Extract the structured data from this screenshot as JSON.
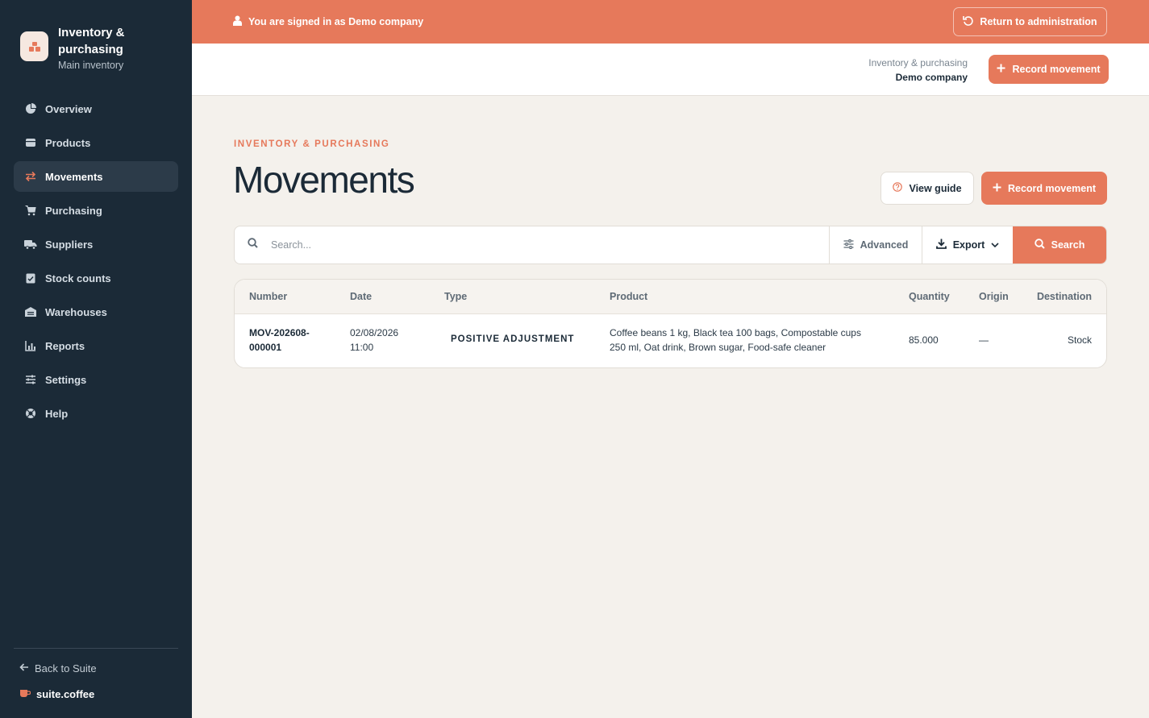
{
  "sidebar": {
    "brand_title": "Inventory & purchasing",
    "brand_subtitle": "Main inventory",
    "items": [
      {
        "label": "Overview",
        "icon": "pie-chart-icon"
      },
      {
        "label": "Products",
        "icon": "box-icon"
      },
      {
        "label": "Movements",
        "icon": "swap-arrows-icon",
        "active": true
      },
      {
        "label": "Purchasing",
        "icon": "cart-icon"
      },
      {
        "label": "Suppliers",
        "icon": "truck-icon"
      },
      {
        "label": "Stock counts",
        "icon": "clipboard-check-icon"
      },
      {
        "label": "Warehouses",
        "icon": "warehouse-icon"
      },
      {
        "label": "Reports",
        "icon": "bar-chart-icon"
      },
      {
        "label": "Settings",
        "icon": "sliders-icon"
      },
      {
        "label": "Help",
        "icon": "lifebuoy-icon"
      }
    ],
    "back_label": "Back to Suite",
    "suite_label": "suite.coffee"
  },
  "banner": {
    "text": "You are signed in as Demo company",
    "return_label": "Return to administration"
  },
  "header": {
    "app_name": "Inventory & purchasing",
    "company": "Demo company",
    "record_label": "Record movement"
  },
  "page": {
    "eyebrow": "INVENTORY & PURCHASING",
    "title": "Movements",
    "guide_label": "View guide",
    "record_label": "Record movement"
  },
  "search": {
    "placeholder": "Search...",
    "advanced_label": "Advanced",
    "export_label": "Export",
    "search_label": "Search"
  },
  "table": {
    "columns": [
      "Number",
      "Date",
      "Type",
      "Product",
      "Quantity",
      "Origin",
      "Destination"
    ],
    "rows": [
      {
        "number_line1": "MOV-202608-",
        "number_line2": "000001",
        "date": "02/08/2026",
        "time": "11:00",
        "type": "POSITIVE ADJUSTMENT",
        "product_line1": "Coffee beans 1 kg, Black tea 100 bags, Compostable cups",
        "product_line2": "250 ml, Oat drink, Brown sugar, Food-safe cleaner",
        "quantity": "85.000",
        "origin": "—",
        "destination": "Stock"
      }
    ]
  },
  "colors": {
    "accent": "#e6795b",
    "sidebar_bg": "#1b2a37",
    "page_bg": "#f4f1ec"
  }
}
